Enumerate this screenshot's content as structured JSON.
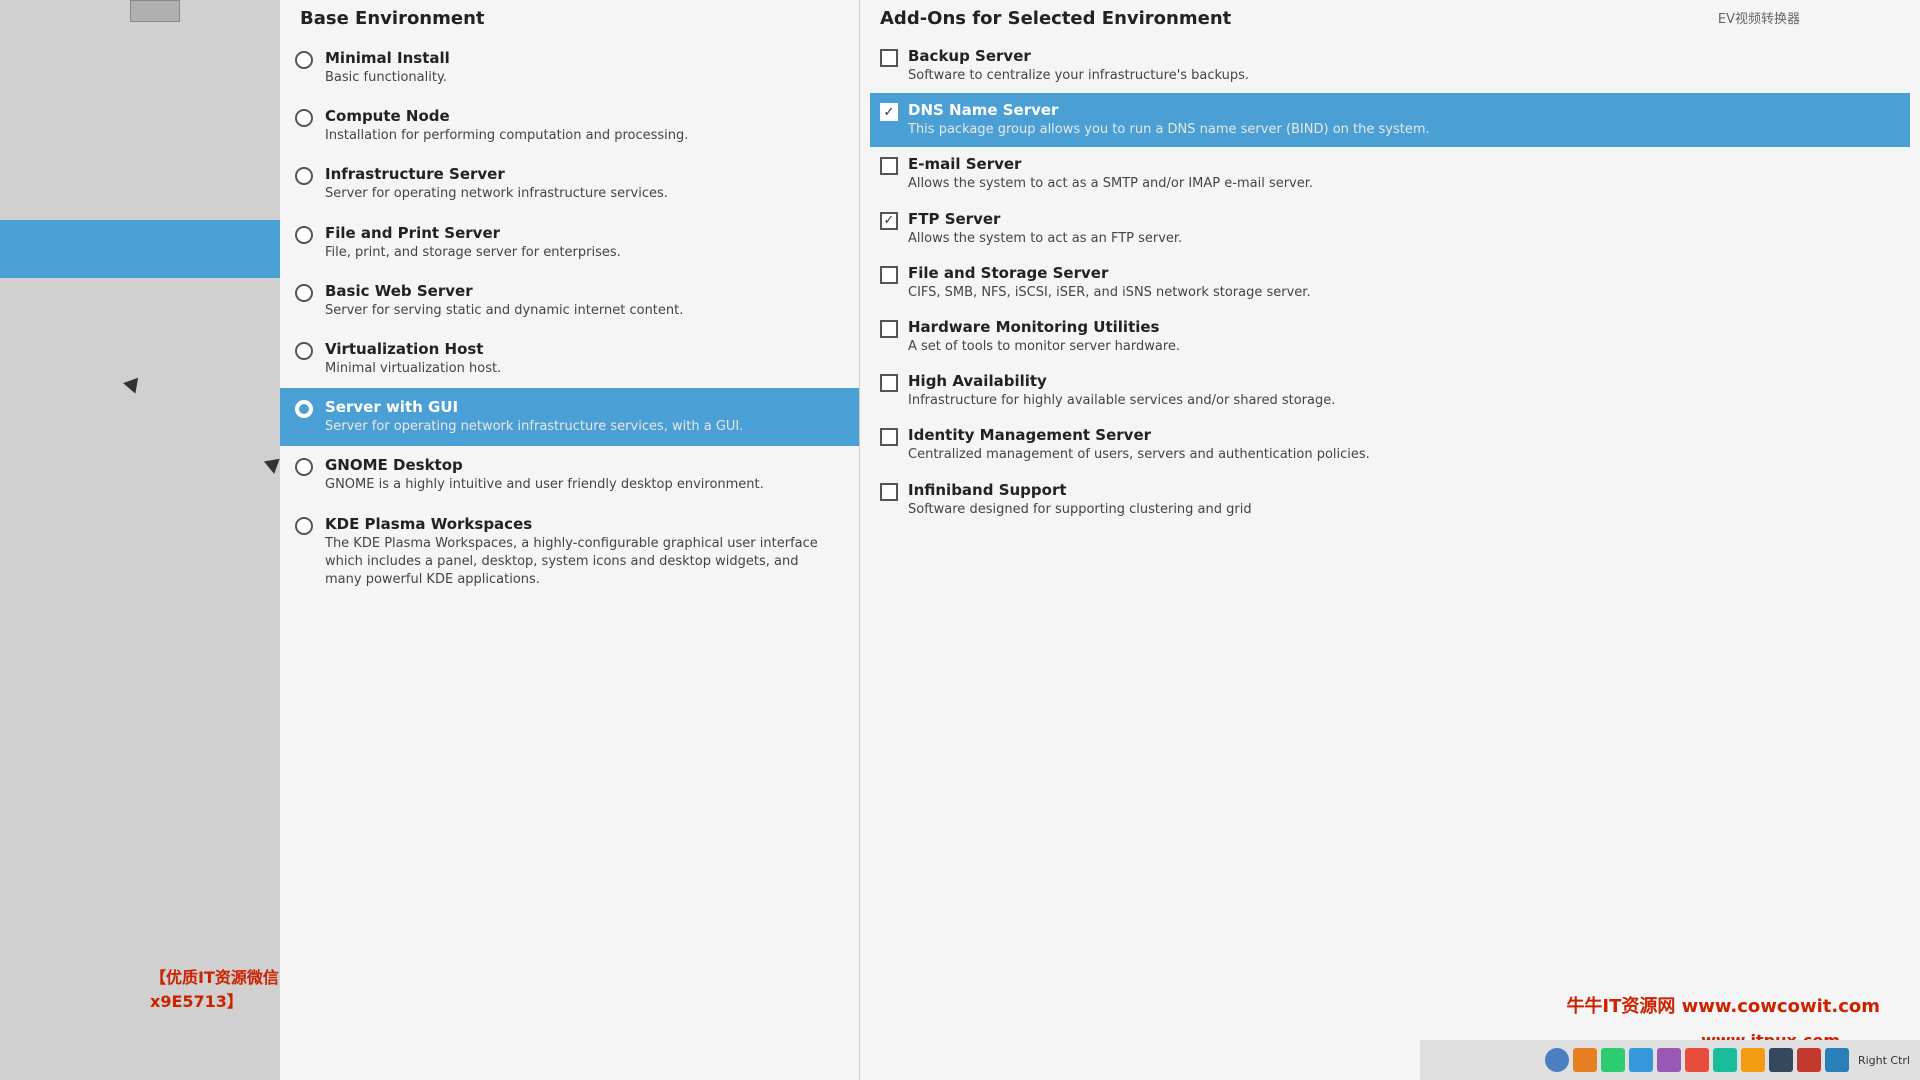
{
  "header": {
    "base_env_label": "Base Environment",
    "addons_label": "Add-Ons for Selected Environment"
  },
  "base_environments": [
    {
      "id": "minimal",
      "title": "Minimal Install",
      "desc": "Basic functionality.",
      "selected": false,
      "radio_filled": false
    },
    {
      "id": "compute",
      "title": "Compute Node",
      "desc": "Installation for performing computation and processing.",
      "selected": false,
      "radio_filled": false
    },
    {
      "id": "infrastructure",
      "title": "Infrastructure Server",
      "desc": "Server for operating network infrastructure services.",
      "selected": false,
      "radio_filled": false
    },
    {
      "id": "file-print",
      "title": "File and Print Server",
      "desc": "File, print, and storage server for enterprises.",
      "selected": false,
      "radio_filled": false
    },
    {
      "id": "basic-web",
      "title": "Basic Web Server",
      "desc": "Server for serving static and dynamic internet content.",
      "selected": false,
      "radio_filled": false
    },
    {
      "id": "virtualization",
      "title": "Virtualization Host",
      "desc": "Minimal virtualization host.",
      "selected": false,
      "radio_filled": false
    },
    {
      "id": "server-gui",
      "title": "Server with GUI",
      "desc": "Server for operating network infrastructure services, with a GUI.",
      "selected": true,
      "radio_filled": true
    },
    {
      "id": "gnome",
      "title": "GNOME Desktop",
      "desc": "GNOME is a highly intuitive and user friendly desktop environment.",
      "selected": false,
      "radio_filled": false
    },
    {
      "id": "kde",
      "title": "KDE Plasma Workspaces",
      "desc": "The KDE Plasma Workspaces, a highly-configurable graphical user interface which includes a panel, desktop, system icons and desktop widgets, and many powerful KDE applications.",
      "selected": false,
      "radio_filled": false
    }
  ],
  "addons": [
    {
      "id": "backup",
      "title": "Backup Server",
      "desc": "Software to centralize your infrastructure's backups.",
      "checked": false,
      "selected": false
    },
    {
      "id": "dns",
      "title": "DNS Name Server",
      "desc": "This package group allows you to run a DNS name server (BIND) on the system.",
      "checked": true,
      "selected": true
    },
    {
      "id": "email",
      "title": "E-mail Server",
      "desc": "Allows the system to act as a SMTP and/or IMAP e-mail server.",
      "checked": false,
      "selected": false
    },
    {
      "id": "ftp",
      "title": "FTP Server",
      "desc": "Allows the system to act as an FTP server.",
      "checked": true,
      "selected": false
    },
    {
      "id": "file-storage",
      "title": "File and Storage Server",
      "desc": "CIFS, SMB, NFS, iSCSI, iSER, and iSNS network storage server.",
      "checked": false,
      "selected": false
    },
    {
      "id": "hardware-monitoring",
      "title": "Hardware Monitoring Utilities",
      "desc": "A set of tools to monitor server hardware.",
      "checked": false,
      "selected": false
    },
    {
      "id": "high-availability",
      "title": "High Availability",
      "desc": "Infrastructure for highly available services and/or shared storage.",
      "checked": false,
      "selected": false
    },
    {
      "id": "identity",
      "title": "Identity Management Server",
      "desc": "Centralized management of users, servers and authentication policies.",
      "checked": false,
      "selected": false
    },
    {
      "id": "infiniband",
      "title": "Infiniband Support",
      "desc": "Software designed for supporting clustering and grid",
      "checked": false,
      "selected": false
    }
  ],
  "watermarks": {
    "left_text": "【优质IT资源微信x9E5713】",
    "right_text": "牛牛IT资源网 www.cowcowit.com",
    "www_text": "www.itpux.com",
    "ev_text": "EV视频转换器"
  }
}
